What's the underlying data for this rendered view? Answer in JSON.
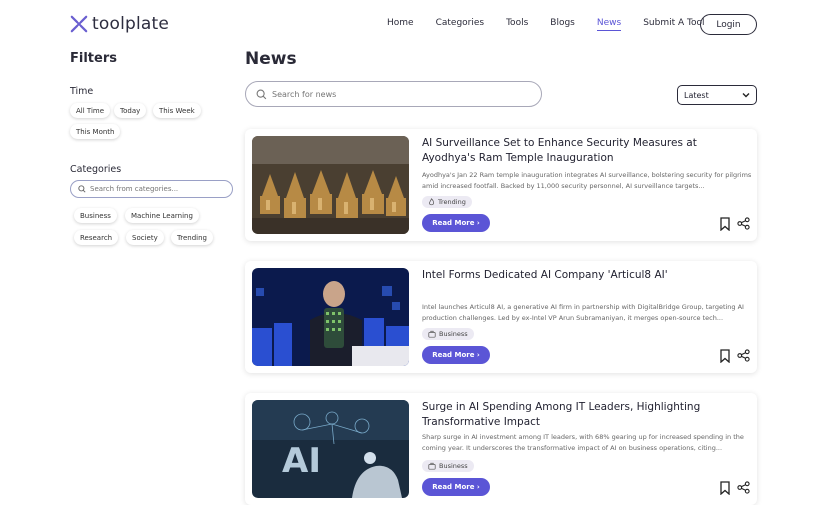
{
  "header": {
    "logo_text": "toolplate",
    "nav": [
      "Home",
      "Categories",
      "Tools",
      "Blogs",
      "News",
      "Submit A Tool"
    ],
    "active_nav": "News",
    "login_label": "Login"
  },
  "sidebar": {
    "title": "Filters",
    "time_title": "Time",
    "time_options": [
      "All Time",
      "Today",
      "This Week",
      "This Month"
    ],
    "categories_title": "Categories",
    "categories_search_placeholder": "Search from categories...",
    "categories": [
      "Business",
      "Machine Learning",
      "Research",
      "Society",
      "Trending"
    ]
  },
  "main": {
    "title": "News",
    "search_placeholder": "Search for news",
    "sort_value": "Latest",
    "read_more_label": "Read More",
    "articles": [
      {
        "title": "AI Surveillance Set to Enhance Security Measures at Ayodhya's Ram Temple Inauguration",
        "description": "Ayodhya's Jan 22 Ram temple inauguration integrates AI surveillance, bolstering security for pilgrims amid increased footfall. Backed by 11,000 security personnel, AI surveillance targets...",
        "tag": "Trending",
        "tag_icon": "flame-icon"
      },
      {
        "title": "Intel Forms Dedicated AI Company 'Articul8 AI'",
        "description": "Intel launches Articul8 AI, a generative AI firm in partnership with DigitalBridge Group, targeting AI production challenges. Led by ex-Intel VP Arun Subramaniyan, it merges open-source tech...",
        "tag": "Business",
        "tag_icon": "briefcase-icon"
      },
      {
        "title": "Surge in AI Spending Among IT Leaders, Highlighting Transformative Impact",
        "description": "Sharp surge in AI investment among IT leaders, with 68% gearing up for increased spending in the coming year. It underscores the transformative impact of AI on business operations, citing...",
        "tag": "Business",
        "tag_icon": "briefcase-icon"
      }
    ]
  },
  "colors": {
    "accent": "#5b55d6",
    "text": "#1f1f2e"
  }
}
